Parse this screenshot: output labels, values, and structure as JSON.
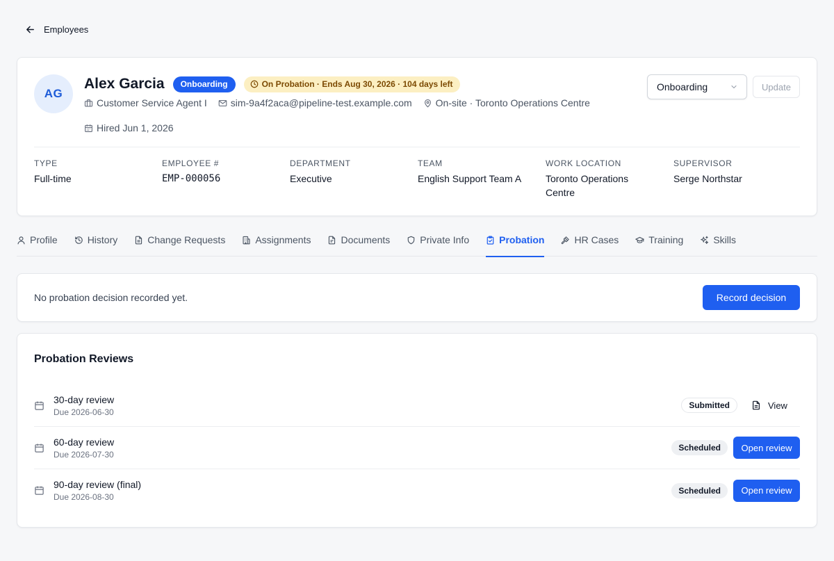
{
  "nav": {
    "back_label": "Employees"
  },
  "employee": {
    "initials": "AG",
    "name": "Alex Garcia",
    "status_badge": "Onboarding",
    "probation_badge": "On Probation · Ends Aug 30, 2026 · 104 days left",
    "job_title": "Customer Service Agent I",
    "email": "sim-9a4f2aca@pipeline-test.example.com",
    "location": "On-site · Toronto Operations Centre",
    "hired": "Hired Jun 1, 2026"
  },
  "status_control": {
    "selected": "Onboarding",
    "update_label": "Update"
  },
  "fields": [
    {
      "label": "Type",
      "value": "Full-time"
    },
    {
      "label": "Employee #",
      "value": "EMP-000056"
    },
    {
      "label": "Department",
      "value": "Executive"
    },
    {
      "label": "Team",
      "value": "English Support Team A"
    },
    {
      "label": "Work Location",
      "value": "Toronto Operations Centre"
    },
    {
      "label": "Supervisor",
      "value": "Serge Northstar"
    }
  ],
  "tabs": [
    {
      "label": "Profile",
      "icon": "user-icon"
    },
    {
      "label": "History",
      "icon": "history-icon"
    },
    {
      "label": "Change Requests",
      "icon": "file-icon"
    },
    {
      "label": "Assignments",
      "icon": "building-icon"
    },
    {
      "label": "Documents",
      "icon": "document-icon"
    },
    {
      "label": "Private Info",
      "icon": "shield-icon"
    },
    {
      "label": "Probation",
      "icon": "clipboard-check-icon",
      "active": true
    },
    {
      "label": "HR Cases",
      "icon": "gavel-icon"
    },
    {
      "label": "Training",
      "icon": "graduation-cap-icon"
    },
    {
      "label": "Skills",
      "icon": "sparkles-icon"
    }
  ],
  "decision": {
    "message": "No probation decision recorded yet.",
    "button_label": "Record decision"
  },
  "reviews": {
    "title": "Probation Reviews",
    "items": [
      {
        "title": "30-day review",
        "due": "Due 2026-06-30",
        "status": "Submitted",
        "action": "View"
      },
      {
        "title": "60-day review",
        "due": "Due 2026-07-30",
        "status": "Scheduled",
        "action": "Open review"
      },
      {
        "title": "90-day review (final)",
        "due": "Due 2026-08-30",
        "status": "Scheduled",
        "action": "Open review"
      }
    ]
  },
  "colors": {
    "primary": "#1f5ff0",
    "warning_bg": "#fcefc2",
    "warning_text": "#7c4a03",
    "avatar_bg": "#e5eefd"
  }
}
